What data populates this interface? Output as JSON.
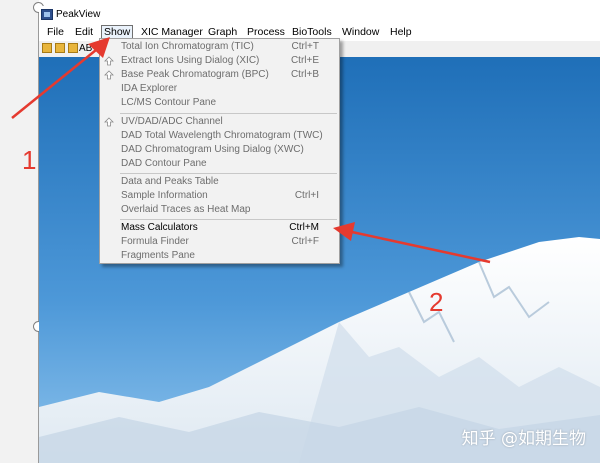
{
  "window": {
    "title": "PeakView"
  },
  "menubar": {
    "items": [
      {
        "label": "File"
      },
      {
        "label": "Edit"
      },
      {
        "label": "Show"
      },
      {
        "label": "XIC Manager"
      },
      {
        "label": "Graph"
      },
      {
        "label": "Process"
      },
      {
        "label": "BioTools"
      },
      {
        "label": "Window"
      },
      {
        "label": "Help"
      }
    ],
    "active": "Show"
  },
  "toolbar": {
    "visible_text": "AB"
  },
  "show_menu": {
    "items": [
      {
        "label": "Total Ion Chromatogram (TIC)",
        "shortcut": "Ctrl+T",
        "enabled": false,
        "icon": "none"
      },
      {
        "label": "Extract Ions Using Dialog (XIC)",
        "shortcut": "Ctrl+E",
        "enabled": false,
        "icon": "up-arrow-icon"
      },
      {
        "label": "Base Peak Chromatogram (BPC)",
        "shortcut": "Ctrl+B",
        "enabled": false,
        "icon": "up-arrow-icon"
      },
      {
        "label": "IDA Explorer",
        "shortcut": "",
        "enabled": false,
        "icon": "none"
      },
      {
        "label": "LC/MS Contour Pane",
        "shortcut": "",
        "enabled": false,
        "icon": "none"
      },
      {
        "label": "UV/DAD/ADC Channel",
        "shortcut": "",
        "enabled": false,
        "icon": "up-arrow-icon"
      },
      {
        "label": "DAD Total Wavelength Chromatogram (TWC)",
        "shortcut": "",
        "enabled": false,
        "icon": "none"
      },
      {
        "label": "DAD Chromatogram Using Dialog (XWC)",
        "shortcut": "",
        "enabled": false,
        "icon": "none"
      },
      {
        "label": "DAD Contour Pane",
        "shortcut": "",
        "enabled": false,
        "icon": "none"
      },
      {
        "label": "Data and Peaks Table",
        "shortcut": "",
        "enabled": false,
        "icon": "none"
      },
      {
        "label": "Sample Information",
        "shortcut": "Ctrl+I",
        "enabled": false,
        "icon": "none"
      },
      {
        "label": "Overlaid Traces as Heat Map",
        "shortcut": "",
        "enabled": false,
        "icon": "none"
      },
      {
        "label": "Mass Calculators",
        "shortcut": "Ctrl+M",
        "enabled": true,
        "icon": "none"
      },
      {
        "label": "Formula Finder",
        "shortcut": "Ctrl+F",
        "enabled": false,
        "icon": "none"
      },
      {
        "label": "Fragments Pane",
        "shortcut": "",
        "enabled": false,
        "icon": "none"
      }
    ]
  },
  "annotations": {
    "marker_1": "1",
    "marker_2": "2",
    "arrow_color": "#e53a2f"
  },
  "watermark": "知乎 @如期生物",
  "colors": {
    "sky_top": "#1f6fb8",
    "sky_bottom": "#6fb0e6",
    "menu_bg": "#f2f2f2",
    "disabled_text": "#6d6d6d"
  }
}
